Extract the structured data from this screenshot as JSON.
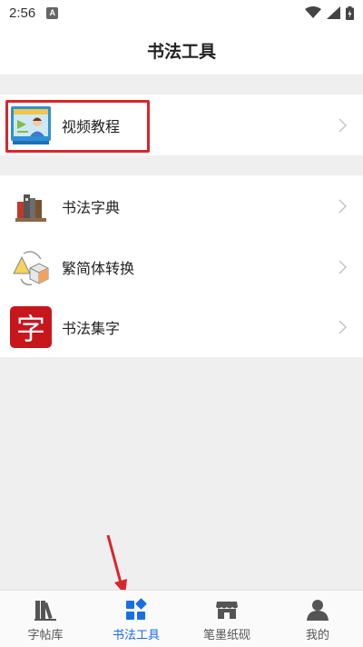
{
  "status_bar": {
    "time": "2:56",
    "notif_letter": "A"
  },
  "header": {
    "title": "书法工具"
  },
  "section1": {
    "items": [
      {
        "label": "视频教程",
        "icon": "video-tutorial-icon"
      }
    ]
  },
  "section2": {
    "items": [
      {
        "label": "书法字典",
        "icon": "books-icon"
      },
      {
        "label": "繁简体转换",
        "icon": "shapes-convert-icon"
      },
      {
        "label": "书法集字",
        "icon": "zi-character-icon",
        "glyph": "字"
      }
    ]
  },
  "bottom_nav": {
    "items": [
      {
        "label": "字帖库",
        "icon": "library-icon",
        "active": false
      },
      {
        "label": "书法工具",
        "icon": "tools-grid-icon",
        "active": true
      },
      {
        "label": "笔墨纸砚",
        "icon": "store-icon",
        "active": false
      },
      {
        "label": "我的",
        "icon": "person-icon",
        "active": false
      }
    ]
  },
  "colors": {
    "accent": "#1a6fe0",
    "highlight": "#d9262c",
    "background": "#efefef"
  }
}
